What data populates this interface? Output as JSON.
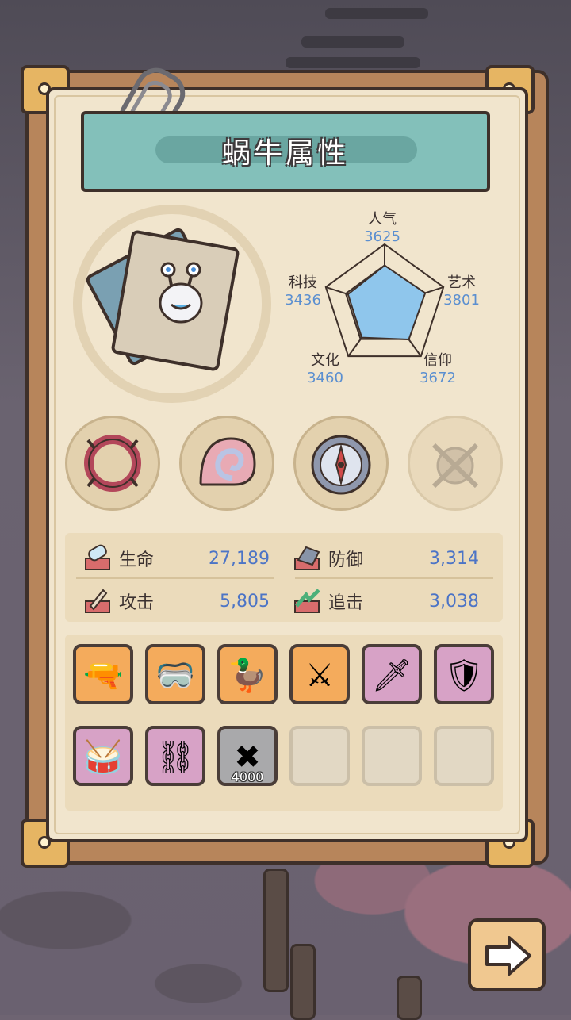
{
  "title": "蜗牛属性",
  "radar": {
    "stats": [
      {
        "label": "人气",
        "value": "3625"
      },
      {
        "label": "艺术",
        "value": "3801"
      },
      {
        "label": "信仰",
        "value": "3672"
      },
      {
        "label": "文化",
        "value": "3460"
      },
      {
        "label": "科技",
        "value": "3436"
      }
    ],
    "fill_color": "#8fc6ec"
  },
  "skills": [
    {
      "icon": "thorny-ring-icon"
    },
    {
      "icon": "spiral-shell-icon"
    },
    {
      "icon": "compass-icon"
    },
    {
      "icon": "locked-chain-orb-icon"
    }
  ],
  "attributes": [
    {
      "label": "生命",
      "value": "27,189",
      "icon": "health-icon"
    },
    {
      "label": "防御",
      "value": "3,314",
      "icon": "defense-icon"
    },
    {
      "label": "攻击",
      "value": "5,805",
      "icon": "attack-icon"
    },
    {
      "label": "追击",
      "value": "3,038",
      "icon": "pursuit-icon"
    }
  ],
  "items": [
    {
      "icon": "pistol-icon",
      "glyph": "🔫",
      "rarity": "orange"
    },
    {
      "icon": "goggles-icon",
      "glyph": "🥽",
      "rarity": "orange"
    },
    {
      "icon": "duck-float-icon",
      "glyph": "🦆",
      "rarity": "orange"
    },
    {
      "icon": "crossed-knives-icon",
      "glyph": "⚔",
      "rarity": "orange"
    },
    {
      "icon": "dagger-icon",
      "glyph": "🗡",
      "rarity": "pink"
    },
    {
      "icon": "shield-icon",
      "glyph": "🛡",
      "rarity": "pink"
    },
    {
      "icon": "drum-icon",
      "glyph": "🥁",
      "rarity": "pink"
    },
    {
      "icon": "chain-icon",
      "glyph": "⛓",
      "rarity": "pink"
    },
    {
      "icon": "locked-slot-icon",
      "glyph": "✖",
      "rarity": "gray",
      "cost": "4000"
    },
    {
      "icon": "",
      "glyph": "",
      "rarity": "empty"
    },
    {
      "icon": "",
      "glyph": "",
      "rarity": "empty"
    },
    {
      "icon": "",
      "glyph": "",
      "rarity": "empty"
    }
  ],
  "next_button": {
    "icon": "right-arrow-icon"
  }
}
